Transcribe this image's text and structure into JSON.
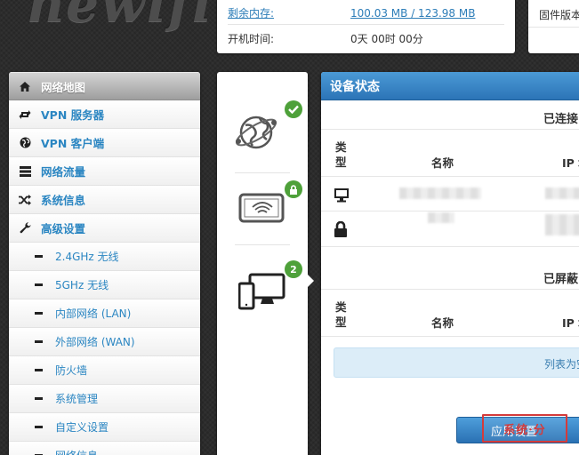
{
  "logo": {
    "text": "newifi"
  },
  "system_info": {
    "memory": {
      "label": "剩余内存:",
      "value": "100.03 MB / 123.98 MB"
    },
    "uptime": {
      "label": "开机时间:",
      "value": "0天 00时 00分"
    }
  },
  "firmware": {
    "label": "固件版本"
  },
  "sidebar": {
    "items": [
      {
        "label": "网络地图",
        "icon": "home-icon",
        "active": true
      },
      {
        "label": "VPN 服务器",
        "icon": "retweet-icon"
      },
      {
        "label": "VPN 客户端",
        "icon": "globe-icon"
      },
      {
        "label": "网络流量",
        "icon": "list-icon"
      },
      {
        "label": "系统信息",
        "icon": "shuffle-icon"
      },
      {
        "label": "高级设置",
        "icon": "wrench-icon"
      }
    ],
    "subitems": [
      {
        "label": "2.4GHz 无线"
      },
      {
        "label": "5GHz 无线"
      },
      {
        "label": "内部网络 (LAN)"
      },
      {
        "label": "外部网络 (WAN)"
      },
      {
        "label": "防火墙"
      },
      {
        "label": "系统管理"
      },
      {
        "label": "自定义设置"
      },
      {
        "label": "网络信息"
      }
    ]
  },
  "device_tabs": [
    {
      "name": "internet",
      "icon": "globe-network-icon",
      "badge_icon": "check-icon"
    },
    {
      "name": "wireless",
      "icon": "wifi-tablet-icon",
      "badge_icon": "lock-icon"
    },
    {
      "name": "clients",
      "icon": "devices-icon",
      "badge": "2"
    }
  ],
  "panel": {
    "title": "设备状态",
    "connected": {
      "title": "已连接",
      "headers": {
        "type": "类型",
        "name": "名称",
        "ip": "IP 地址"
      },
      "rows": [
        {
          "type_icon": "desktop-icon"
        },
        {
          "type_icon": "lock-icon"
        }
      ]
    },
    "blocked": {
      "title": "已屏蔽",
      "headers": {
        "type": "类型",
        "name": "名称",
        "ip": "IP 地址"
      },
      "empty_text": "列表为空"
    },
    "apply_button": "应用设置"
  },
  "watermark": {
    "text": "系统·分"
  },
  "colors": {
    "accent": "#2c74b7",
    "link": "#2b86c2",
    "badge": "#4ea13a"
  }
}
